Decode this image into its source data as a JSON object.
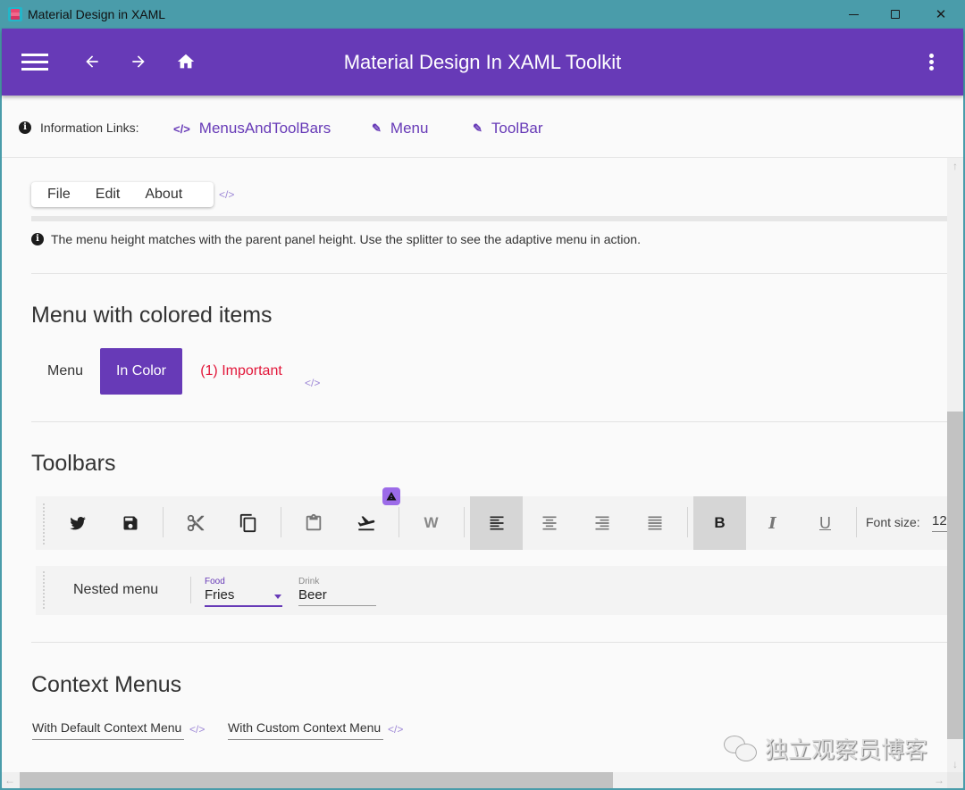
{
  "window": {
    "title": "Material Design in XAML",
    "controls": {
      "minimize": "minimize",
      "maximize": "maximize",
      "close": "✕"
    }
  },
  "appbar": {
    "title": "Material Design In XAML Toolkit",
    "icons": {
      "menu": "hamburger-icon",
      "back": "←",
      "forward": "→",
      "home": "home-icon",
      "more": "more-vert-icon"
    }
  },
  "info_bar": {
    "icon": "i",
    "label": "Information Links:",
    "links": [
      {
        "icon": "</>",
        "label": "MenusAndToolBars"
      },
      {
        "icon": "✎",
        "label": "Menu"
      },
      {
        "icon": "✎",
        "label": "ToolBar"
      }
    ]
  },
  "menu_section": {
    "items": [
      "File",
      "Edit",
      "About"
    ],
    "code_icon": "</>",
    "note_icon": "i",
    "note": "The menu height matches with the parent panel height. Use the splitter to see the adaptive menu in action."
  },
  "colored_section": {
    "heading": "Menu with colored items",
    "items": [
      "Menu",
      "In Color",
      "(1) Important"
    ],
    "code_icon": "</>",
    "colors": {
      "in_color_bg": "#673ab7",
      "important_text": "#e2173a"
    }
  },
  "toolbars_section": {
    "heading": "Toolbars",
    "buttons": [
      "twitter",
      "save",
      "cut",
      "copy",
      "paste",
      "flight-takeoff",
      "W",
      "align-left",
      "align-center",
      "align-right",
      "align-justify",
      "B",
      "I",
      "U"
    ],
    "font_size_label": "Font size:",
    "font_size_value": "12",
    "nested_menu_label": "Nested menu",
    "food_label": "Food",
    "food_value": "Fries",
    "drink_label": "Drink",
    "drink_value": "Beer"
  },
  "context_section": {
    "heading": "Context Menus",
    "fields": [
      "With Default Context Menu",
      "With Custom Context Menu"
    ],
    "code_icon": "</>"
  },
  "watermark": {
    "text": "独立观察员博客"
  },
  "theme": {
    "primary": "#673ab7",
    "titlebar": "#4a9caa",
    "accent_badge": "#9c6be8"
  }
}
